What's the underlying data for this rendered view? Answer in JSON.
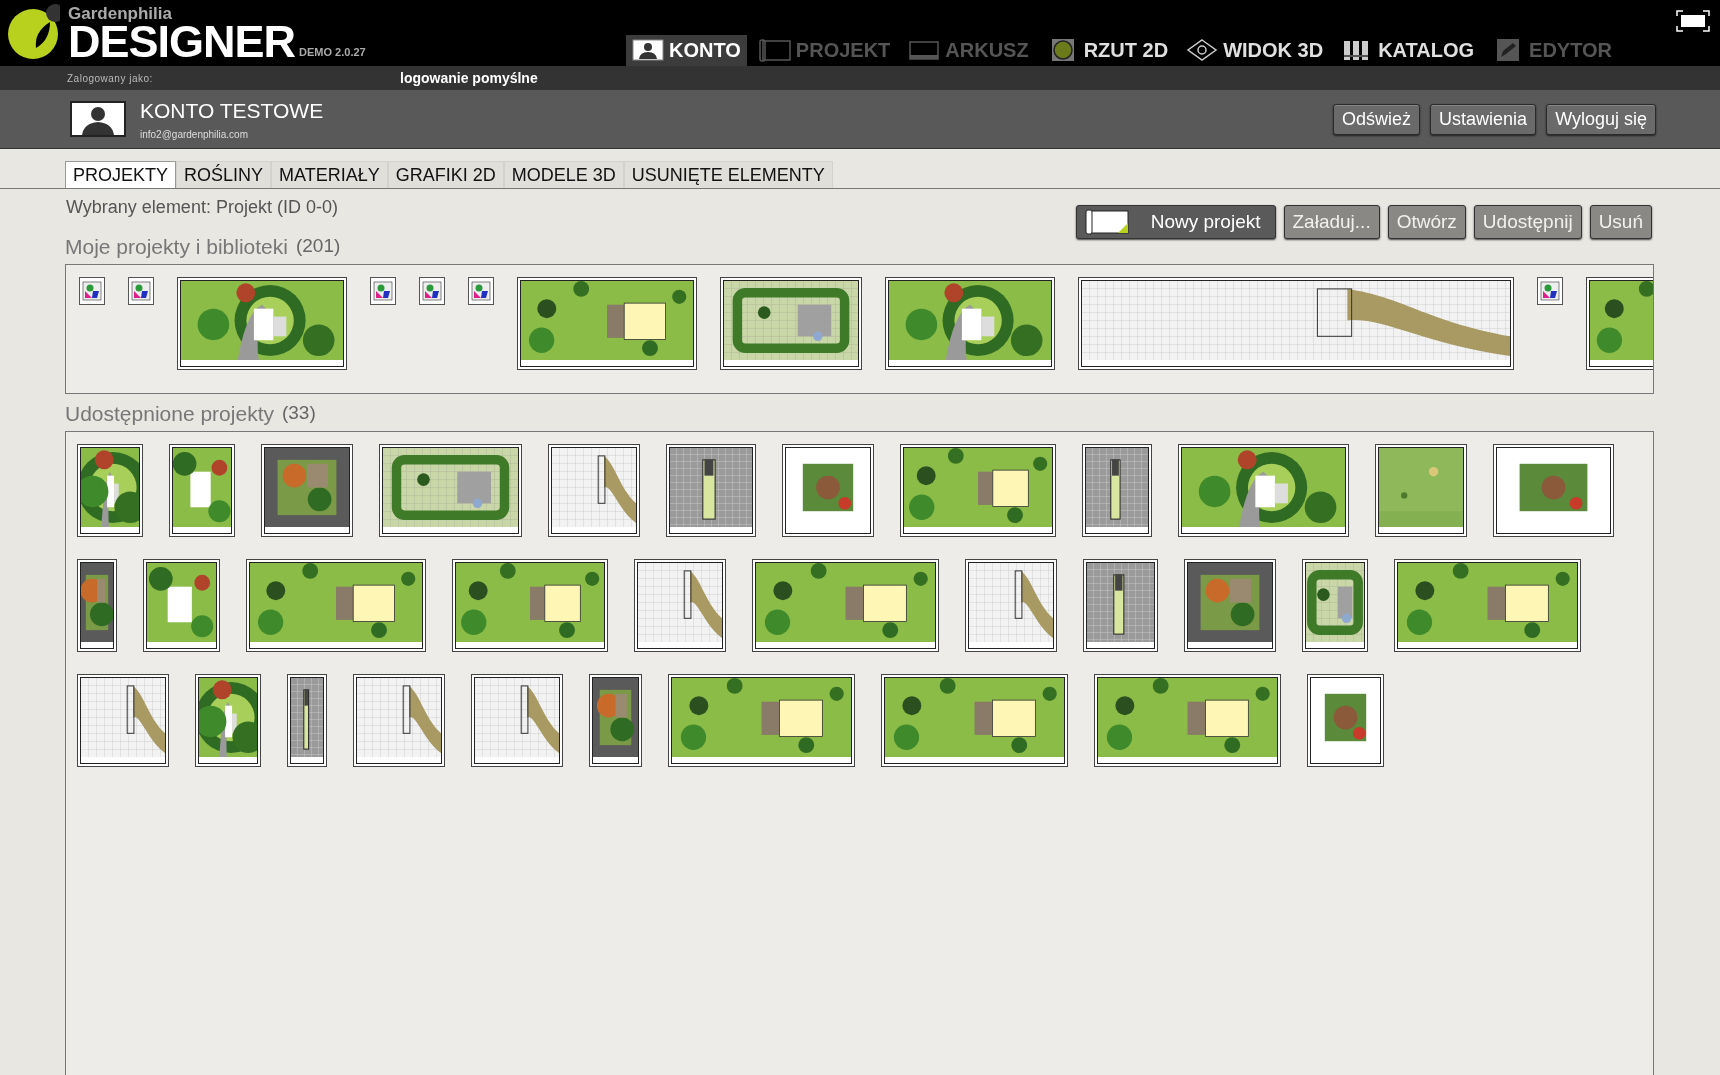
{
  "app": {
    "brand": "Gardenphilia",
    "product": "DESIGNER",
    "version": "DEMO 2.0.27"
  },
  "nav": [
    {
      "label": "KONTO",
      "selected": true,
      "disabled": false
    },
    {
      "label": "PROJEKT",
      "selected": false,
      "disabled": true
    },
    {
      "label": "ARKUSZ",
      "selected": false,
      "disabled": true
    },
    {
      "label": "RZUT 2D",
      "selected": false,
      "disabled": false
    },
    {
      "label": "WIDOK 3D",
      "selected": false,
      "disabled": false
    },
    {
      "label": "KATALOG",
      "selected": false,
      "disabled": false
    },
    {
      "label": "EDYTOR",
      "selected": false,
      "disabled": true
    }
  ],
  "status": {
    "logged_in_label": "Zalogowany jako:",
    "message": "logowanie pomyślne"
  },
  "account": {
    "name": "KONTO TESTOWE",
    "email": "info2@gardenphilia.com",
    "buttons": [
      "Odśwież",
      "Ustawienia",
      "Wyloguj się"
    ]
  },
  "tabs": [
    {
      "label": "PROJEKTY",
      "selected": true
    },
    {
      "label": "ROŚLINY",
      "selected": false
    },
    {
      "label": "MATERIAŁY",
      "selected": false
    },
    {
      "label": "GRAFIKI 2D",
      "selected": false
    },
    {
      "label": "MODELE 3D",
      "selected": false
    },
    {
      "label": "USUNIĘTE ELEMENTY",
      "selected": false
    }
  ],
  "selected_element": "Wybrany element: Projekt (ID 0-0)",
  "actions": [
    {
      "label": "Nowy projekt",
      "disabled": false
    },
    {
      "label": "Załaduj...",
      "disabled": true
    },
    {
      "label": "Otwórz",
      "disabled": true
    },
    {
      "label": "Udostępnij",
      "disabled": true
    },
    {
      "label": "Usuń",
      "disabled": true
    }
  ],
  "my_projects": {
    "title": "Moje projekty i biblioteki",
    "count": "(201)",
    "items": [
      {
        "kind": "library"
      },
      {
        "kind": "library"
      },
      {
        "kind": "picture"
      },
      {
        "kind": "library"
      },
      {
        "kind": "library"
      },
      {
        "kind": "library"
      },
      {
        "kind": "picture"
      },
      {
        "kind": "picture"
      },
      {
        "kind": "picture"
      },
      {
        "kind": "picture"
      },
      {
        "kind": "library"
      },
      {
        "kind": "picture"
      }
    ]
  },
  "shared_projects": {
    "title": "Udostępnione projekty",
    "count": "(33)",
    "items": [
      {
        "kind": "picture"
      },
      {
        "kind": "picture"
      },
      {
        "kind": "picture"
      },
      {
        "kind": "picture"
      },
      {
        "kind": "picture"
      },
      {
        "kind": "picture"
      },
      {
        "kind": "picture"
      },
      {
        "kind": "picture"
      },
      {
        "kind": "picture"
      },
      {
        "kind": "picture"
      },
      {
        "kind": "picture"
      },
      {
        "kind": "picture"
      },
      {
        "kind": "picture"
      },
      {
        "kind": "picture"
      },
      {
        "kind": "picture"
      },
      {
        "kind": "picture"
      },
      {
        "kind": "picture"
      },
      {
        "kind": "picture"
      },
      {
        "kind": "picture"
      },
      {
        "kind": "picture"
      },
      {
        "kind": "picture"
      },
      {
        "kind": "picture"
      },
      {
        "kind": "picture"
      },
      {
        "kind": "picture"
      },
      {
        "kind": "picture"
      },
      {
        "kind": "picture"
      },
      {
        "kind": "picture"
      },
      {
        "kind": "picture"
      },
      {
        "kind": "picture"
      },
      {
        "kind": "picture"
      },
      {
        "kind": "picture"
      },
      {
        "kind": "picture"
      },
      {
        "kind": "picture"
      }
    ]
  }
}
